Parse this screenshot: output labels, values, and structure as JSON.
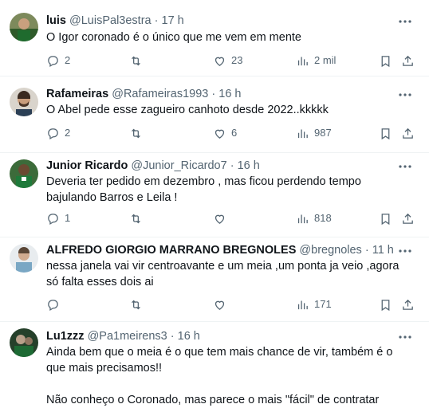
{
  "tweets": [
    {
      "name": "luis",
      "handle": "@LuisPal3estra",
      "dot": "·",
      "time": "17 h",
      "text": [
        "O Igor coronado é o único que me vem em mente"
      ],
      "replies": "2",
      "retweets": "",
      "likes": "23",
      "views": "2 mil"
    },
    {
      "name": "Rafameiras",
      "handle": "@Rafameiras1993",
      "dot": "·",
      "time": "16 h",
      "text": [
        "O Abel pede esse zagueiro canhoto desde 2022..kkkkk"
      ],
      "replies": "2",
      "retweets": "",
      "likes": "6",
      "views": "987"
    },
    {
      "name": "Junior Ricardo",
      "handle": "@Junior_Ricardo7",
      "dot": "·",
      "time": "16 h",
      "text": [
        "Deveria ter pedido em dezembro , mas ficou perdendo tempo bajulando Barros e Leila !"
      ],
      "replies": "1",
      "retweets": "",
      "likes": "",
      "views": "818"
    },
    {
      "name": "ALFREDO GIORGIO MARRANO BREGNOLES",
      "handle": "@bregnoles",
      "dot": "·",
      "time": "11 h",
      "text": [
        "nessa janela vai vir centroavante e um meia ,um ponta ja veio ,agora só falta esses dois ai"
      ],
      "replies": "",
      "retweets": "",
      "likes": "",
      "views": "171"
    },
    {
      "name": "Lu1zzz",
      "handle": "@Pa1meirens3",
      "dot": "·",
      "time": "16 h",
      "text": [
        "Ainda bem que o meia é o que tem mais chance de vir, também é o que mais precisamos!!",
        "Não conheço o Coronado, mas parece o mais \"fácil\" de contratar"
      ],
      "replies": "",
      "retweets": "",
      "likes": "",
      "views": ""
    }
  ],
  "icons": {
    "reply": "reply-icon",
    "retweet": "retweet-icon",
    "like": "like-icon",
    "views": "views-icon",
    "bookmark": "bookmark-icon",
    "share": "share-icon",
    "more": "more-icon"
  },
  "colors": {
    "text": "#0f1419",
    "secondary": "#536471",
    "divider": "#eff3f4"
  }
}
